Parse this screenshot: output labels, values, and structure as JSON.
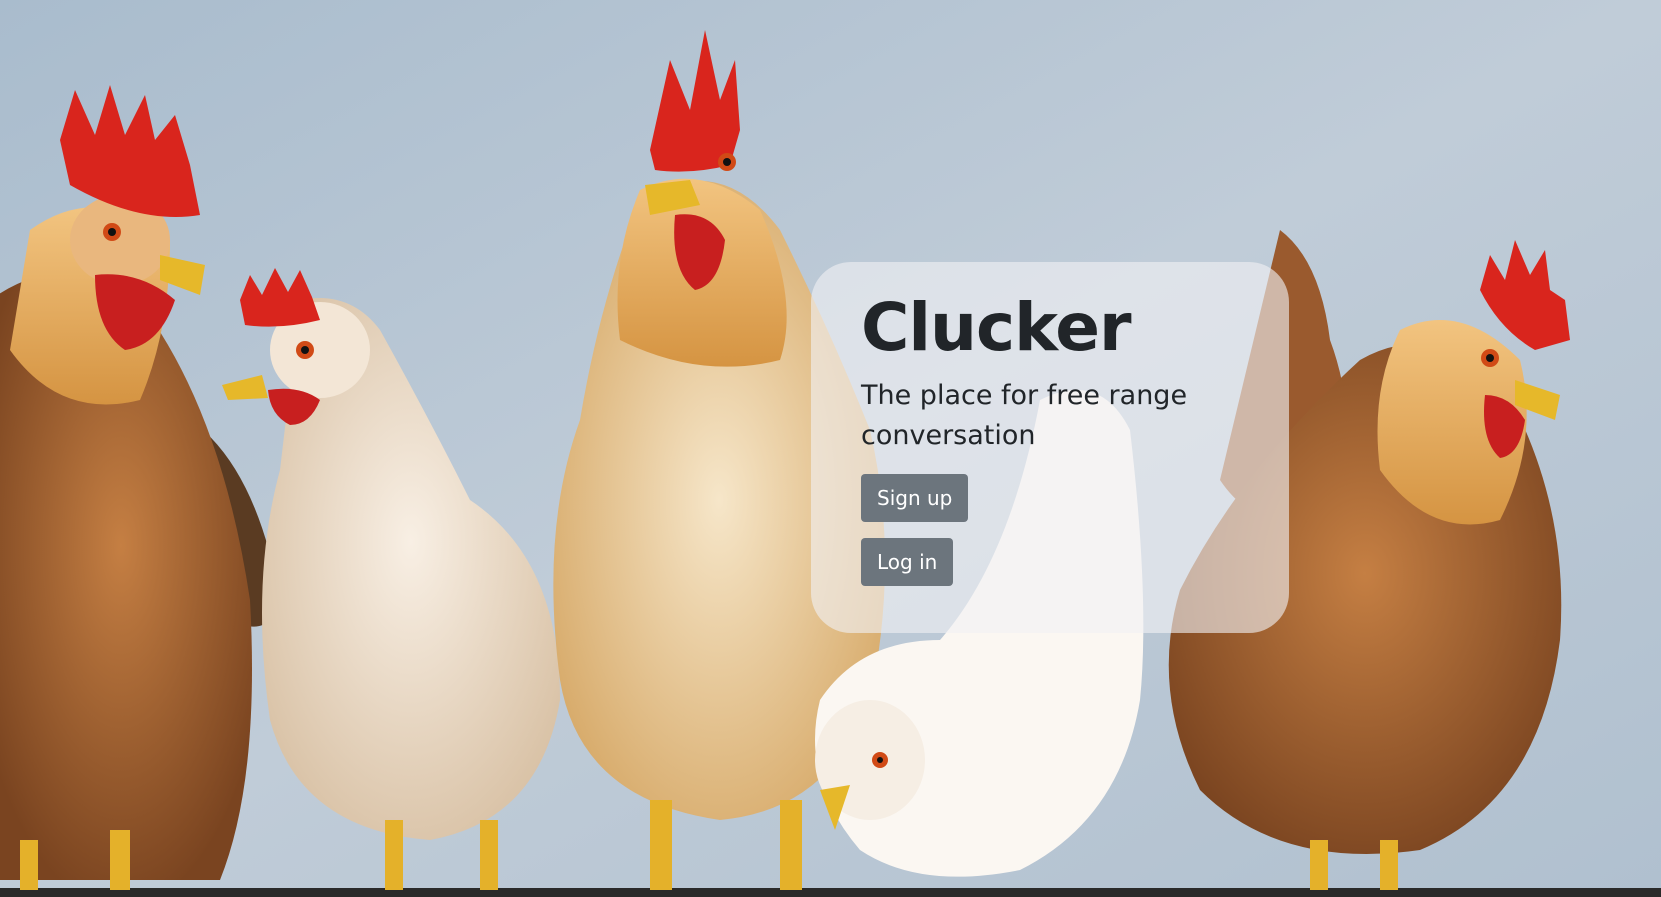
{
  "app": {
    "title": "Clucker",
    "tagline": "The place for free range conversation"
  },
  "actions": {
    "signup_label": "Sign up",
    "login_label": "Log in"
  },
  "colors": {
    "button": "#6c757d",
    "text": "#212529",
    "card": "rgba(240,240,244,0.62)",
    "background": "#b3c3d2"
  },
  "icons": {
    "background_image": "chickens-photo"
  }
}
